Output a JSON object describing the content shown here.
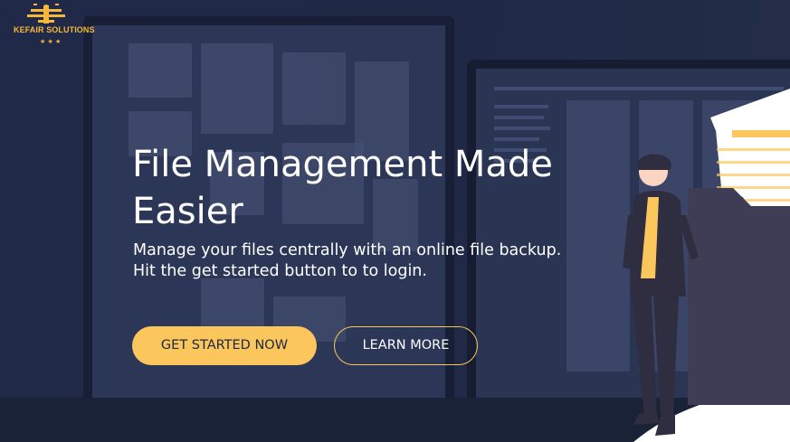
{
  "brand": {
    "name": "KEFAIR SOLUTIONS",
    "stars": "★ ★ ★"
  },
  "hero": {
    "title_line1": "File Management Made",
    "title_line2": "Easier",
    "subtitle_line1": "Manage your files centrally with an online file backup.",
    "subtitle_line2": "Hit the get started button to to login."
  },
  "buttons": {
    "get_started": "GET STARTED NOW",
    "learn_more": "LEARN MORE"
  },
  "colors": {
    "background": "#1e2744",
    "accent": "#fbc65b",
    "text": "#ffffff"
  },
  "icons": {
    "logo": "airplane-logo-icon",
    "illustration": "person-with-document-illustration"
  }
}
